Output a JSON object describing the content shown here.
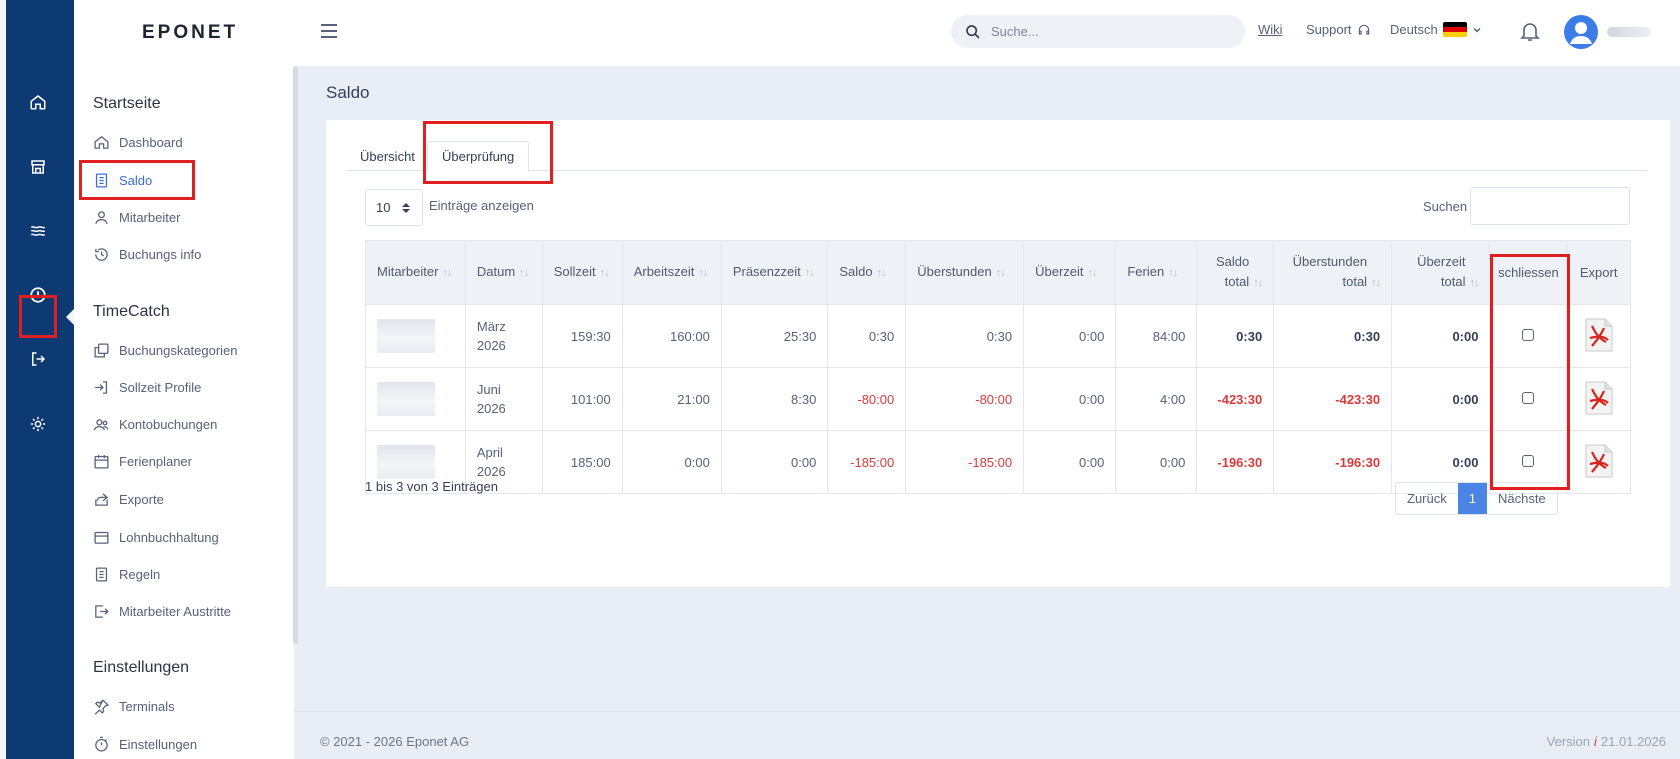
{
  "brand": "EPONET",
  "search": {
    "placeholder": "Suche..."
  },
  "topbar": {
    "wiki": "Wiki",
    "support": "Support",
    "language": "Deutsch"
  },
  "nav": {
    "sections": [
      {
        "title": "Startseite",
        "items": [
          "Dashboard",
          "Saldo",
          "Mitarbeiter",
          "Buchungs info"
        ]
      },
      {
        "title": "TimeCatch",
        "items": [
          "Buchungskategorien",
          "Sollzeit Profile",
          "Kontobuchungen",
          "Ferienplaner",
          "Exporte",
          "Lohnbuchhaltung",
          "Regeln",
          "Mitarbeiter Austritte"
        ]
      },
      {
        "title": "Einstellungen",
        "items": [
          "Terminals",
          "Einstellungen"
        ]
      }
    ],
    "active": "Saldo"
  },
  "page": {
    "title": "Saldo"
  },
  "tabs": [
    "Übersicht",
    "Überprüfung"
  ],
  "active_tab": "Überprüfung",
  "table_controls": {
    "page_length": "10",
    "length_label": "Einträge anzeigen",
    "search_label": "Suchen"
  },
  "table": {
    "headers": [
      "Mitarbeiter",
      "Datum",
      "Sollzeit",
      "Arbeitszeit",
      "Präsenzzeit",
      "Saldo",
      "Überstunden",
      "Überzeit",
      "Ferien",
      "Saldo total",
      "Überstunden total",
      "Überzeit total",
      "schliessen",
      "Export"
    ],
    "rows": [
      {
        "datum": "März 2026",
        "sollzeit": "159:30",
        "arbeitszeit": "160:00",
        "praesenzzeit": "25:30",
        "saldo": "0:30",
        "ueberstunden": "0:30",
        "ueberzeit": "0:00",
        "ferien": "84:00",
        "saldo_total": "0:30",
        "ueberstunden_total": "0:30",
        "ueberzeit_total": "0:00"
      },
      {
        "datum": "Juni 2026",
        "sollzeit": "101:00",
        "arbeitszeit": "21:00",
        "praesenzzeit": "8:30",
        "saldo": "-80:00",
        "ueberstunden": "-80:00",
        "ueberzeit": "0:00",
        "ferien": "4:00",
        "saldo_total": "-423:30",
        "ueberstunden_total": "-423:30",
        "ueberzeit_total": "0:00"
      },
      {
        "datum": "April 2026",
        "sollzeit": "185:00",
        "arbeitszeit": "0:00",
        "praesenzzeit": "0:00",
        "saldo": "-185:00",
        "ueberstunden": "-185:00",
        "ueberzeit": "0:00",
        "ferien": "0:00",
        "saldo_total": "-196:30",
        "ueberstunden_total": "-196:30",
        "ueberzeit_total": "0:00"
      }
    ]
  },
  "table_info": "1 bis 3 von 3 Einträgen",
  "pagination": {
    "prev": "Zurück",
    "current": "1",
    "next": "Nächste"
  },
  "footer": {
    "copyright": "© 2021 - 2026 Eponet AG",
    "version_label": "Version",
    "version_info": "i",
    "version_date": "21.01.2026"
  },
  "colors": {
    "rail": "#0d3a73",
    "accent": "#3b6fd8",
    "negative": "#d83b3b",
    "highlight": "#e02020"
  }
}
